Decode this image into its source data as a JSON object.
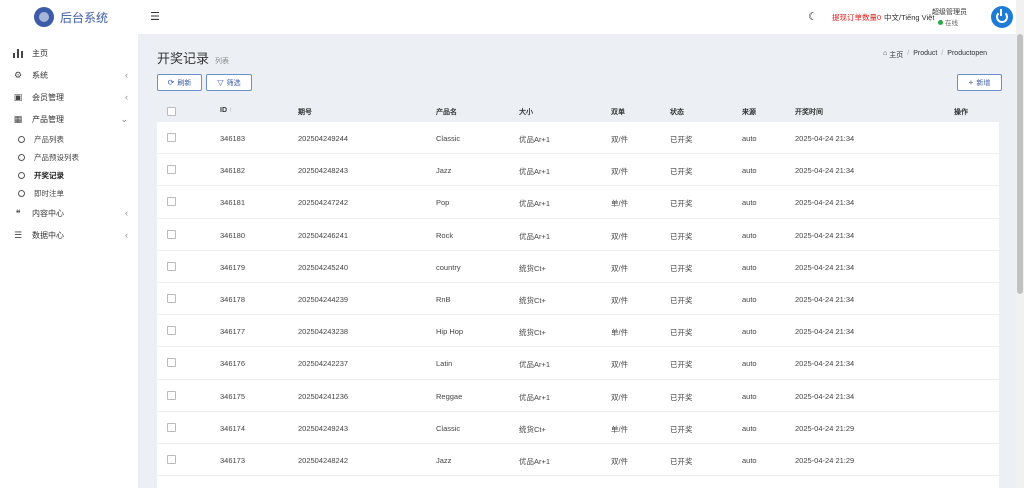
{
  "brand": {
    "name": "后台系统"
  },
  "sidebar": {
    "items": [
      {
        "label": "主页",
        "icon": "bar-chart-icon",
        "glyph": "▮",
        "arrow": ""
      },
      {
        "label": "系统",
        "icon": "gear-icon",
        "glyph": "⚙",
        "arrow": "‹"
      },
      {
        "label": "会员管理",
        "icon": "id-card-icon",
        "glyph": "▣",
        "arrow": "‹"
      },
      {
        "label": "产品管理",
        "icon": "grid-icon",
        "glyph": "▦",
        "arrow": "⌄"
      }
    ],
    "sub_items": [
      {
        "label": "产品列表"
      },
      {
        "label": "产品预设列表"
      },
      {
        "label": "开奖记录"
      },
      {
        "label": "即时注单"
      }
    ],
    "items_after": [
      {
        "label": "内容中心",
        "icon": "comments-icon",
        "glyph": "❝",
        "arrow": "‹"
      },
      {
        "label": "数据中心",
        "icon": "database-icon",
        "glyph": "☰",
        "arrow": "‹"
      }
    ]
  },
  "topbar": {
    "withdraw_label": "提现订单数量0",
    "language": "中文/Tiếng Việt",
    "admin_name": "超级管理员",
    "admin_status": "在线"
  },
  "page": {
    "title": "开奖记录",
    "subtitle": "列表",
    "breadcrumb": [
      "主页",
      "Product",
      "Productopen"
    ],
    "buttons": {
      "refresh": "刷新",
      "filter": "筛选",
      "add": "新增"
    }
  },
  "table": {
    "headers": {
      "id": "ID",
      "period": "期号",
      "product": "产品名",
      "size": "大小",
      "odd_even": "双单",
      "status": "状态",
      "source": "来源",
      "open_time": "开奖时间",
      "actions": "操作"
    },
    "rows": [
      {
        "id": "346183",
        "period": "202504249244",
        "product": "Classic",
        "size": "优品Ar+1",
        "odd_even": "双/件",
        "status": "已开奖",
        "source": "auto",
        "open_time": "2025-04-24 21:34"
      },
      {
        "id": "346182",
        "period": "202504248243",
        "product": "Jazz",
        "size": "优品Ar+1",
        "odd_even": "双/件",
        "status": "已开奖",
        "source": "auto",
        "open_time": "2025-04-24 21:34"
      },
      {
        "id": "346181",
        "period": "202504247242",
        "product": "Pop",
        "size": "优品Ar+1",
        "odd_even": "单/件",
        "status": "已开奖",
        "source": "auto",
        "open_time": "2025-04-24 21:34"
      },
      {
        "id": "346180",
        "period": "202504246241",
        "product": "Rock",
        "size": "优品Ar+1",
        "odd_even": "双/件",
        "status": "已开奖",
        "source": "auto",
        "open_time": "2025-04-24 21:34"
      },
      {
        "id": "346179",
        "period": "202504245240",
        "product": "country",
        "size": "统货Ct+",
        "odd_even": "双/件",
        "status": "已开奖",
        "source": "auto",
        "open_time": "2025-04-24 21:34"
      },
      {
        "id": "346178",
        "period": "202504244239",
        "product": "RnB",
        "size": "统货Ct+",
        "odd_even": "双/件",
        "status": "已开奖",
        "source": "auto",
        "open_time": "2025-04-24 21:34"
      },
      {
        "id": "346177",
        "period": "202504243238",
        "product": "Hip Hop",
        "size": "统货Ct+",
        "odd_even": "单/件",
        "status": "已开奖",
        "source": "auto",
        "open_time": "2025-04-24 21:34"
      },
      {
        "id": "346176",
        "period": "202504242237",
        "product": "Latin",
        "size": "优品Ar+1",
        "odd_even": "双/件",
        "status": "已开奖",
        "source": "auto",
        "open_time": "2025-04-24 21:34"
      },
      {
        "id": "346175",
        "period": "202504241236",
        "product": "Reggae",
        "size": "优品Ar+1",
        "odd_even": "双/件",
        "status": "已开奖",
        "source": "auto",
        "open_time": "2025-04-24 21:34"
      },
      {
        "id": "346174",
        "period": "202504249243",
        "product": "Classic",
        "size": "统货Ct+",
        "odd_even": "单/件",
        "status": "已开奖",
        "source": "auto",
        "open_time": "2025-04-24 21:29"
      },
      {
        "id": "346173",
        "period": "202504248242",
        "product": "Jazz",
        "size": "优品Ar+1",
        "odd_even": "双/件",
        "status": "已开奖",
        "source": "auto",
        "open_time": "2025-04-24 21:29"
      }
    ]
  }
}
